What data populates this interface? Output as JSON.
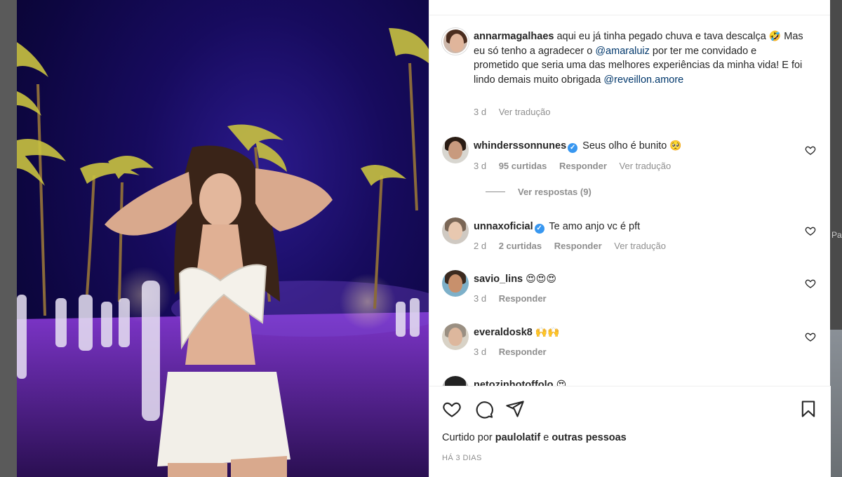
{
  "backdrop": {
    "peek_text": "Pa"
  },
  "post": {
    "author": "annarmagalhaes",
    "caption_part1": "aqui eu já tinha pegado chuva e tava descalça",
    "caption_emoji": "🤣",
    "caption_part2": " Mas eu só tenho a agradecer o ",
    "mention1": "@amaraluiz",
    "caption_part3": " por ter me convidado e prometido que seria uma das melhores experiências da minha vida! E foi lindo demais muito obrigada ",
    "mention2": "@reveillon.amore",
    "time": "3 d",
    "translate": "Ver tradução"
  },
  "comments": [
    {
      "user": "whinderssonnunes",
      "verified": true,
      "text": "Seus olho é bunito",
      "emoji": "🥺",
      "time": "3 d",
      "likes": "95 curtidas",
      "reply": "Responder",
      "translate": "Ver tradução"
    },
    {
      "user": "unnaxoficial",
      "verified": true,
      "text": "Te amo anjo vc é pft",
      "emoji": "",
      "time": "2 d",
      "likes": "2 curtidas",
      "reply": "Responder",
      "translate": "Ver tradução"
    },
    {
      "user": "savio_lins",
      "verified": false,
      "text": "",
      "emoji": "😍😍😍",
      "time": "3 d",
      "reply": "Responder"
    },
    {
      "user": "everaldosk8",
      "verified": false,
      "text": "",
      "emoji": "🙌🙌",
      "time": "3 d",
      "reply": "Responder"
    },
    {
      "user": "netozinhotoffolo",
      "verified": false,
      "text": "",
      "emoji": "😍"
    }
  ],
  "view_replies": "Ver respostas (9)",
  "actions": {
    "icons": [
      "heart-icon",
      "comment-icon",
      "share-icon",
      "bookmark-icon"
    ],
    "liked_by_prefix": "Curtido por",
    "liked_by_user": "paulolatif",
    "liked_by_and": "e",
    "liked_by_others": "outras pessoas",
    "date": "HÁ 3 DIAS"
  },
  "colors": {
    "mention": "#00376b",
    "muted": "#8e8e8e",
    "verified": "#3897f0",
    "photo_sky": "#170b5e",
    "photo_grass": "#6a2fb0"
  }
}
